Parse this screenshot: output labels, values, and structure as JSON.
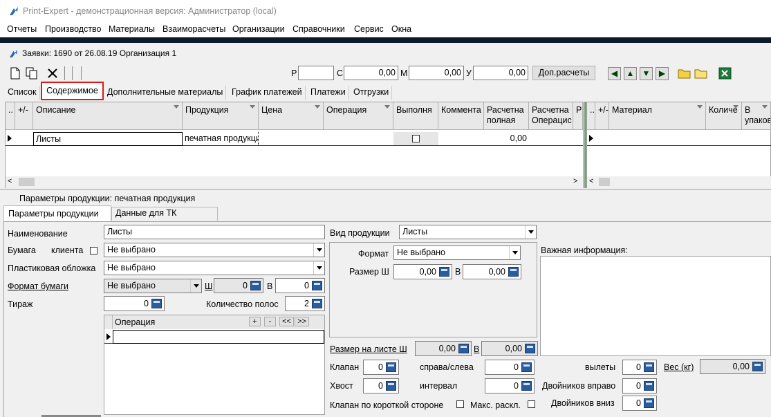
{
  "window": {
    "title": "Print-Expert - демонстрационная версия: Администратор (local)"
  },
  "menu": [
    "Отчеты",
    "Производство",
    "Материалы",
    "Взаиморасчеты",
    "Организации",
    "Справочники",
    "Сервис",
    "Окна"
  ],
  "subwindow": {
    "title": "Заявки: 1690 от 26.08.19  Организация 1"
  },
  "toolbar": {
    "p_label": "Р",
    "p_value": "",
    "c_label": "С",
    "c_value": "0,00",
    "m_label": "М",
    "m_value": "0,00",
    "u_label": "У",
    "u_value": "0,00",
    "extra_calc": "Доп.расчеты"
  },
  "tabs": {
    "list": "Список",
    "content": "Содержимое",
    "extra_materials": "Дополнительные материалы",
    "payment_schedule": "График платежей",
    "payments": "Платежи",
    "shipments": "Отгрузки"
  },
  "grid_left": {
    "plusminus": "+/-",
    "columns": [
      "Описание",
      "Продукция",
      "Цена",
      "Операция",
      "Выполня",
      "Коммента",
      "Расчетна полная",
      "Расчетна Операцис"
    ],
    "row": {
      "description": "Листы",
      "product": "печатная продукция",
      "total": "0,00"
    }
  },
  "grid_right": {
    "plusminus": "+/-",
    "columns": [
      "Материал",
      "Количе",
      "В упаков"
    ]
  },
  "product_params": {
    "header": "Параметры продукции: печатная продукция",
    "tab_params": "Параметры продукции",
    "tab_tk": "Данные для ТК",
    "name_label": "Наименование",
    "name_value": "Листы",
    "paper_label": "Бумага",
    "client_label": "клиента",
    "paper_value": "Не выбрано",
    "plastic_label": "Пластиковая обложка",
    "plastic_value": "Не выбрано",
    "format_label": "Формат бумаги",
    "format_value": "Не выбрано",
    "w_label": "Ш",
    "w_value": "0",
    "h_label": "В",
    "h_value": "0",
    "tirazh_label": "Тираж",
    "tirazh_value": "0",
    "pages_label": "Количество полос",
    "pages_value": "2",
    "op_header": "Операция",
    "op_buttons": [
      "+",
      "-",
      "<<",
      ">>"
    ],
    "type_label": "Вид продукции",
    "type_value": "Листы",
    "format2_label": "Формат",
    "format2_value": "Не выбрано",
    "size_label": "Размер Ш",
    "size_w": "0,00",
    "size_h_label": "В",
    "size_h": "0,00",
    "important_label": "Важная информация:",
    "sheet_size_label": "Размер на листе Ш",
    "sheet_w": "0,00",
    "sheet_h_label": "В",
    "sheet_h": "0,00",
    "klapan_label": "Клапан",
    "klapan_value": "0",
    "side_label": "справа/слева",
    "side_value": "0",
    "vylety_label": "вылеты",
    "vylety_value": "0",
    "weight_label": "Вес (кг)",
    "weight_value": "0,00",
    "tail_label": "Хвост",
    "tail_value": "0",
    "interval_label": "интервал",
    "interval_value": "0",
    "twins_right_label": "Двойников вправо",
    "twins_right_value": "0",
    "short_side_label": "Клапан по короткой стороне",
    "max_layout_label": "Макс. раскл.",
    "twins_down_label": "Двойников вниз",
    "twins_down_value": "0"
  }
}
